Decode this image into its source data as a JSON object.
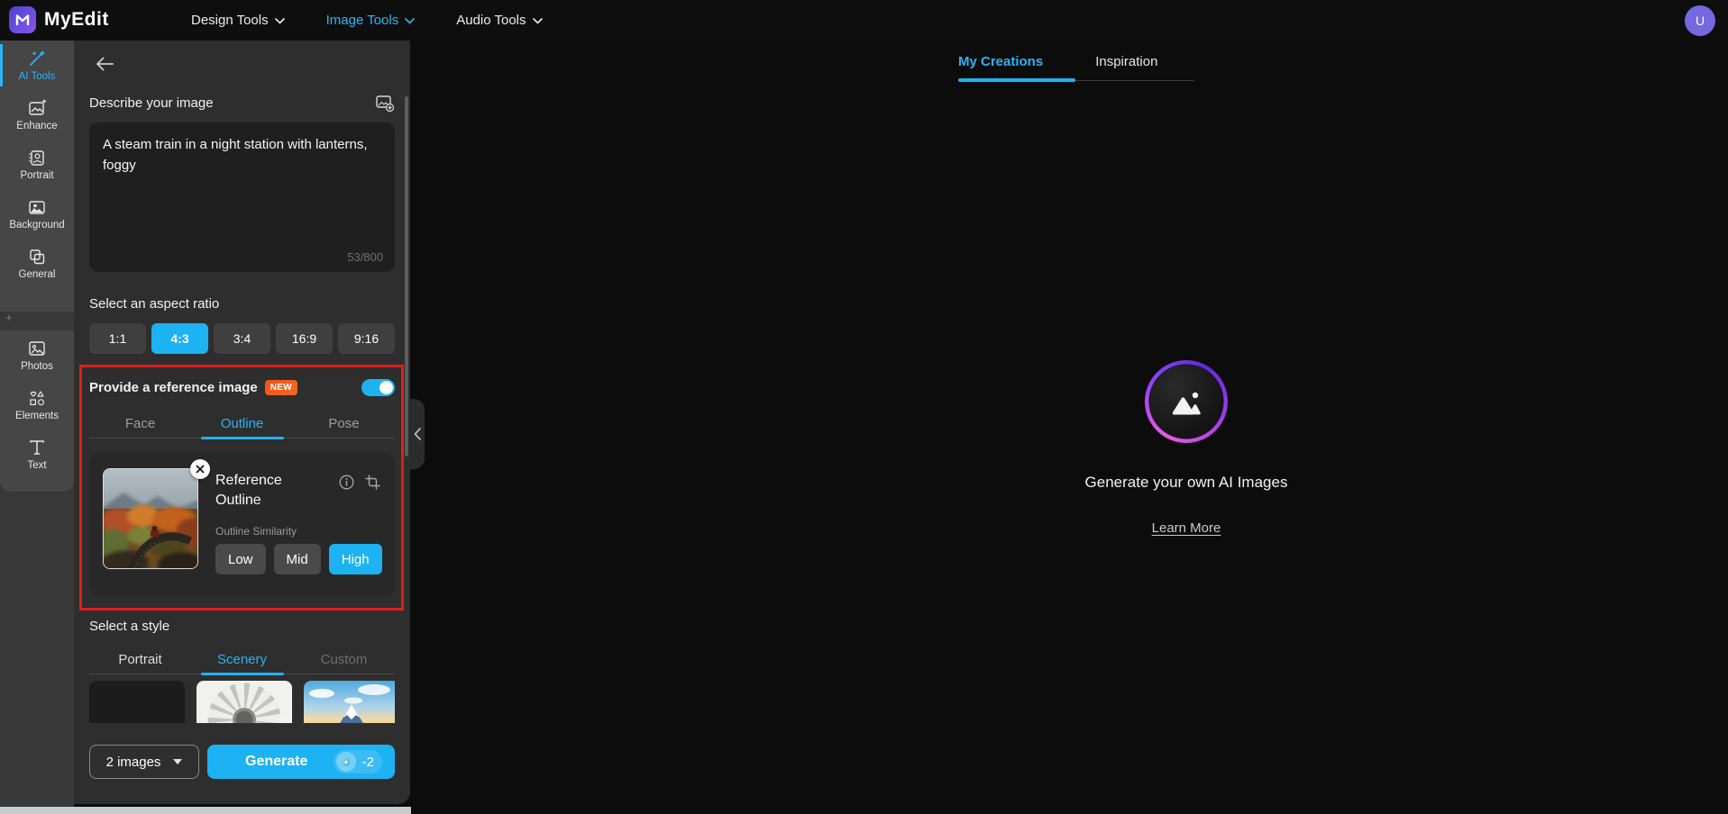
{
  "navbar": {
    "brand": "MyEdit",
    "logo_icon": "myedit-logo",
    "items": [
      {
        "label": "Design Tools",
        "active": false
      },
      {
        "label": "Image Tools",
        "active": true
      },
      {
        "label": "Audio Tools",
        "active": false
      }
    ],
    "avatar_initial": "U"
  },
  "sidebar": {
    "items": [
      {
        "label": "AI Tools",
        "icon": "magic-wand-icon",
        "active": true
      },
      {
        "label": "Enhance",
        "icon": "enhance-icon",
        "active": false
      },
      {
        "label": "Portrait",
        "icon": "portrait-icon",
        "active": false
      },
      {
        "label": "Background",
        "icon": "background-icon",
        "active": false
      },
      {
        "label": "General",
        "icon": "general-icon",
        "active": false
      },
      {
        "label": "Photos",
        "icon": "photos-icon",
        "active": false
      },
      {
        "label": "Elements",
        "icon": "elements-icon",
        "active": false
      },
      {
        "label": "Text",
        "icon": "text-icon",
        "active": false
      }
    ],
    "divider_icon": "plus-icon",
    "divider_glyph": "+"
  },
  "panel": {
    "back_icon": "back-arrow-icon",
    "describe": {
      "label": "Describe your image",
      "action_icon": "add-image-icon",
      "value": "A steam train in a night station with lanterns, foggy",
      "counter": "53/800"
    },
    "aspect": {
      "label": "Select an aspect ratio",
      "options": [
        "1:1",
        "4:3",
        "3:4",
        "16:9",
        "9:16"
      ],
      "selected": "4:3"
    },
    "reference": {
      "label": "Provide a reference image",
      "badge": "NEW",
      "toggle_on": true,
      "tabs": [
        "Face",
        "Outline",
        "Pose"
      ],
      "active_tab": "Outline",
      "card": {
        "title": "Reference Outline",
        "close_icon": "close-icon",
        "info_icon": "info-icon",
        "crop_icon": "crop-icon",
        "thumbnail": "autumn-railway-photo",
        "similarity_label": "Outline Similarity",
        "levels": [
          "Low",
          "Mid",
          "High"
        ],
        "selected_level": "High"
      }
    },
    "style": {
      "label": "Select a style",
      "tabs": [
        "Portrait",
        "Scenery",
        "Custom"
      ],
      "active_tab": "Scenery",
      "thumbnails": [
        "blank-style",
        "sunflower-sketch-style",
        "mount-fuji-style"
      ]
    },
    "footer": {
      "count_label": "2 images",
      "caret_icon": "caret-down-icon",
      "generate_label": "Generate",
      "credit_icon": "credit-token-icon",
      "credits": "-2"
    },
    "collapse_icon": "chevron-left-icon"
  },
  "main": {
    "tabs": [
      {
        "label": "My Creations",
        "active": true
      },
      {
        "label": "Inspiration",
        "active": false
      }
    ],
    "empty_state": {
      "icon": "ai-image-icon",
      "title": "Generate your own AI Images",
      "link": "Learn More"
    }
  },
  "colors": {
    "accent": "#1db2f2",
    "badge": "#f4511e",
    "annotation_red": "#e11d1d",
    "avatar_purple": "#7668e0",
    "panel_bg": "#2e2e2e",
    "sidebar_bg": "#464646",
    "page_bg": "#0c0c0c"
  }
}
